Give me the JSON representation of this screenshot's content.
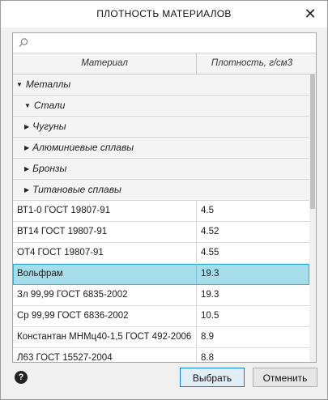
{
  "dialog": {
    "title": "ПЛОТНОСТЬ МАТЕРИАЛОВ",
    "close_glyph": "✕"
  },
  "search": {
    "placeholder": "",
    "value": "",
    "icon": "search-icon"
  },
  "table": {
    "columns": [
      "Материал",
      "Плотность, г/см3"
    ],
    "groups": [
      {
        "label": "Металлы",
        "expanded": true,
        "level": 0
      },
      {
        "label": "Стали",
        "expanded": true,
        "level": 1
      },
      {
        "label": "Чугуны",
        "expanded": false,
        "level": 1
      },
      {
        "label": "Алюминиевые сплавы",
        "expanded": false,
        "level": 1
      },
      {
        "label": "Бронзы",
        "expanded": false,
        "level": 1
      },
      {
        "label": "Титановые сплавы",
        "expanded": false,
        "level": 1
      }
    ],
    "rows": [
      {
        "material": "ВТ1-0 ГОСТ 19807-91",
        "density": "4.5"
      },
      {
        "material": "ВТ14 ГОСТ 19807-91",
        "density": "4.52"
      },
      {
        "material": "ОТ4 ГОСТ 19807-91",
        "density": "4.55"
      },
      {
        "material": "Вольфрам",
        "density": "19.3",
        "selected": true
      },
      {
        "material": "Зл 99,99 ГОСТ 6835-2002",
        "density": "19.3"
      },
      {
        "material": "Ср 99,99 ГОСТ 6836-2002",
        "density": "10.5"
      },
      {
        "material": "Константан МНМц40-1,5 ГОСТ 492-2006",
        "density": "8.9"
      },
      {
        "material": "Л63 ГОСТ 15527-2004",
        "density": "8.8"
      }
    ]
  },
  "footer": {
    "help_glyph": "?",
    "select_label": "Выбрать",
    "cancel_label": "Отменить"
  },
  "colors": {
    "selected_row": "#a6ddea",
    "selected_border": "#2fb4d2",
    "primary_border": "#0d7fd0"
  }
}
